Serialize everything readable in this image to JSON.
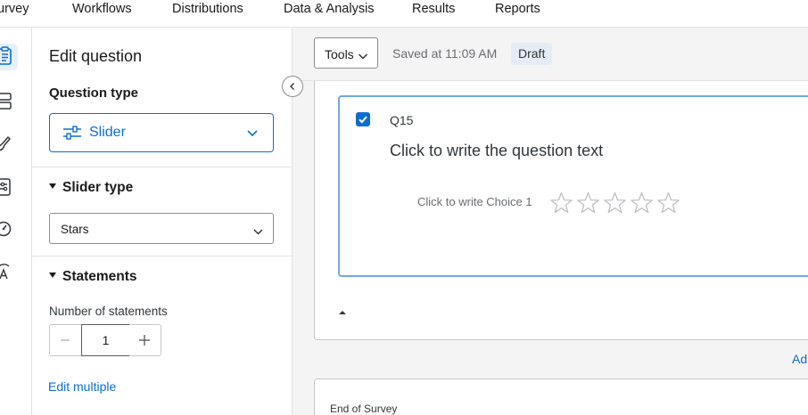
{
  "nav": {
    "tabs": [
      {
        "label": "urvey"
      },
      {
        "label": "Workflows"
      },
      {
        "label": "Distributions"
      },
      {
        "label": "Data & Analysis"
      },
      {
        "label": "Results"
      },
      {
        "label": "Reports"
      }
    ]
  },
  "rail": {
    "icons": [
      "survey-icon",
      "layout-icon",
      "look-and-feel-icon",
      "survey-flow-icon",
      "survey-options-icon",
      "translate-icon"
    ]
  },
  "panel": {
    "title": "Edit question",
    "question_type_heading": "Question type",
    "question_type_value": "Slider",
    "slider_type_heading": "Slider type",
    "slider_type_value": "Stars",
    "statements_heading": "Statements",
    "number_of_statements_label": "Number of statements",
    "number_of_statements_value": "1",
    "edit_multiple": "Edit multiple"
  },
  "toolbar": {
    "tools_label": "Tools",
    "saved_text": "Saved at 11:09 AM",
    "status_badge": "Draft"
  },
  "question": {
    "number": "Q15",
    "text_placeholder": "Click to write the question text",
    "choice_placeholder": "Click to write Choice 1",
    "stars_count": 5,
    "stars_selected": 0,
    "checked": true
  },
  "block": {
    "add_link": "Ad",
    "end_of_survey": "End of Survey"
  },
  "colors": {
    "accent": "#0b6ed0",
    "card_border": "#6fa8e6",
    "badge_bg": "#e4ecf5"
  }
}
